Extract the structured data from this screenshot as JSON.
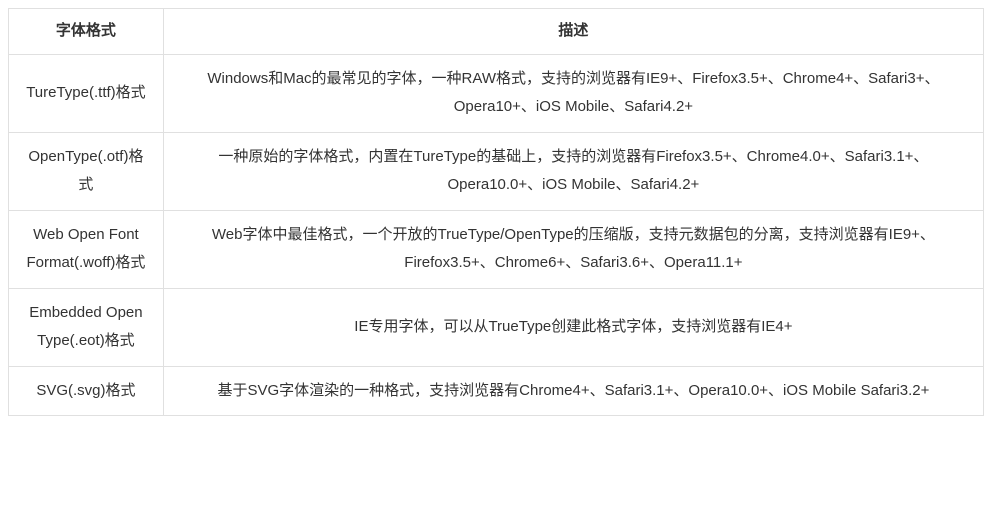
{
  "table": {
    "headers": {
      "format": "字体格式",
      "description": "描述"
    },
    "rows": [
      {
        "format": "TureType(.ttf)格式",
        "description": "Windows和Mac的最常见的字体，一种RAW格式，支持的浏览器有IE9+、Firefox3.5+、Chrome4+、Safari3+、Opera10+、iOS Mobile、Safari4.2+"
      },
      {
        "format": "OpenType(.otf)格式",
        "description": "一种原始的字体格式，内置在TureType的基础上，支持的浏览器有Firefox3.5+、Chrome4.0+、Safari3.1+、Opera10.0+、iOS Mobile、Safari4.2+"
      },
      {
        "format": "Web Open Font Format(.woff)格式",
        "description": "Web字体中最佳格式，一个开放的TrueType/OpenType的压缩版，支持元数据包的分离，支持浏览器有IE9+、Firefox3.5+、Chrome6+、Safari3.6+、Opera11.1+"
      },
      {
        "format": "Embedded Open Type(.eot)格式",
        "description": "IE专用字体，可以从TrueType创建此格式字体，支持浏览器有IE4+"
      },
      {
        "format": "SVG(.svg)格式",
        "description": "基于SVG字体渲染的一种格式，支持浏览器有Chrome4+、Safari3.1+、Opera10.0+、iOS Mobile Safari3.2+"
      }
    ]
  }
}
